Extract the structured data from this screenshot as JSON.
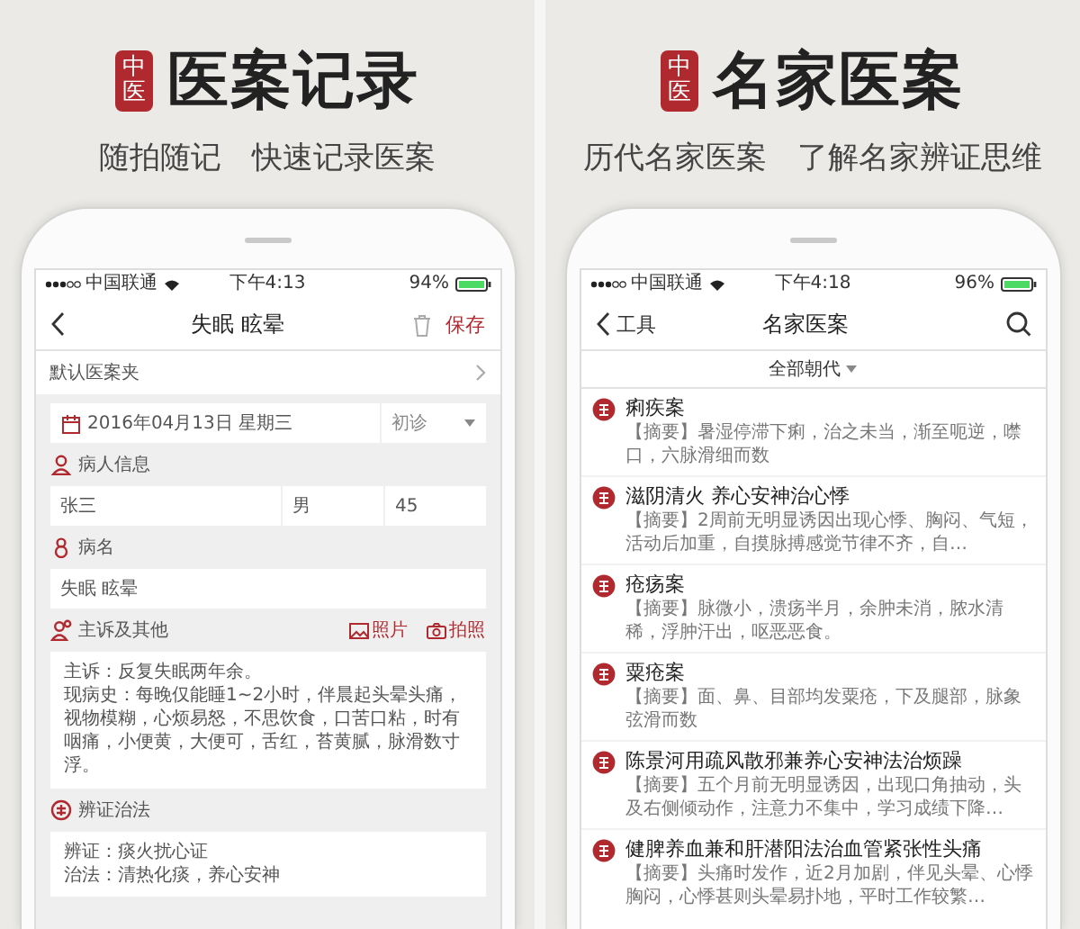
{
  "panels": [
    {
      "seal": "中医",
      "title": "医案记录",
      "subtitle": "随拍随记　快速记录医案",
      "screen": {
        "kind": "record",
        "status": {
          "carrier": "中国联通",
          "time": "下午4:13",
          "battery": "94%"
        },
        "nav": {
          "title": "失眠 眩晕",
          "action": "保存"
        },
        "folder": "默认医案夹",
        "date": "2016年04月13日 星期三",
        "visit": "初诊",
        "sections": [
          {
            "kind": "patient",
            "label": "病人信息",
            "fields": [
              "张三",
              "男",
              "45"
            ]
          },
          {
            "kind": "disease",
            "label": "病名",
            "fields": [
              "失眠 眩晕"
            ]
          },
          {
            "kind": "complaint",
            "label": "主诉及其他",
            "actions": [
              "照片",
              "拍照"
            ],
            "lines": [
              "主诉：反复失眠两年余。",
              "现病史：每晚仅能睡1~2小时，伴晨起头晕头痛，视物模糊，心烦易怒，不思饮食，口苦口粘，时有咽痛，小便黄，大便可，舌红，苔黄腻，脉滑数寸浮。"
            ]
          },
          {
            "kind": "diagnosis",
            "label": "辨证治法",
            "lines": [
              "辨证：痰火扰心证",
              "治法：清热化痰，养心安神"
            ]
          }
        ]
      }
    },
    {
      "seal": "中医",
      "title": "名家医案",
      "subtitle": "历代名家医案　了解名家辨证思维",
      "screen": {
        "kind": "list",
        "status": {
          "carrier": "中国联通",
          "time": "下午4:18",
          "battery": "96%"
        },
        "nav": {
          "back": "工具",
          "title": "名家医案"
        },
        "filter": "全部朝代",
        "cases": [
          {
            "title": "痢疾案",
            "summary": "【摘要】暑湿停滞下痢，治之未当，渐至呃逆，噤口，六脉滑细而数"
          },
          {
            "title": "滋阴清火 养心安神治心悸",
            "summary": "【摘要】2周前无明显诱因出现心悸、胸闷、气短，活动后加重，自摸脉搏感觉节律不齐，自…"
          },
          {
            "title": "疮疡案",
            "summary": "【摘要】脉微小，溃疡半月，余肿未消，脓水清稀，浮肿汗出，呕恶恶食。"
          },
          {
            "title": "粟疮案",
            "summary": "【摘要】面、鼻、目部均发粟疮，下及腿部，脉象弦滑而数"
          },
          {
            "title": "陈景河用疏风散邪兼养心安神法治烦躁",
            "summary": "【摘要】五个月前无明显诱因，出现口角抽动，头及右侧倾动作，注意力不集中，学习成绩下降…"
          },
          {
            "title": "健脾养血兼和肝潜阳法治血管紧张性头痛",
            "summary": "【摘要】头痛时发作，近2月加剧，伴见头晕、心悸胸闷，心悸甚则头晕易扑地，平时工作较繁…"
          }
        ]
      }
    }
  ]
}
